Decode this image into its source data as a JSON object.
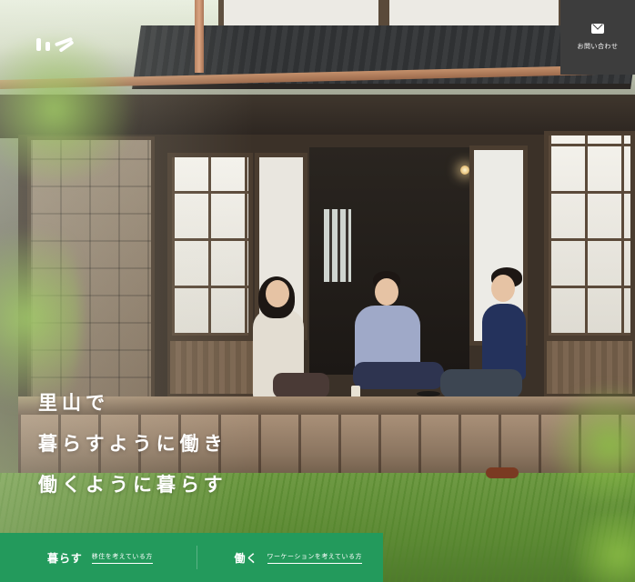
{
  "header": {
    "logo_icon": "site-logo",
    "contact": {
      "icon": "mail-icon",
      "label": "お問い合わせ"
    }
  },
  "hero": {
    "catch_lines": [
      "里山で",
      "暮らすように働き",
      "働くように暮らす"
    ]
  },
  "bottom_nav": {
    "items": [
      {
        "label": "暮らす",
        "sub": "移住を考えている方"
      },
      {
        "label": "働く",
        "sub": "ワーケーションを考えている方"
      }
    ]
  },
  "colors": {
    "accent_green": "#239a5c",
    "contact_bg": "#3d3d3d"
  }
}
